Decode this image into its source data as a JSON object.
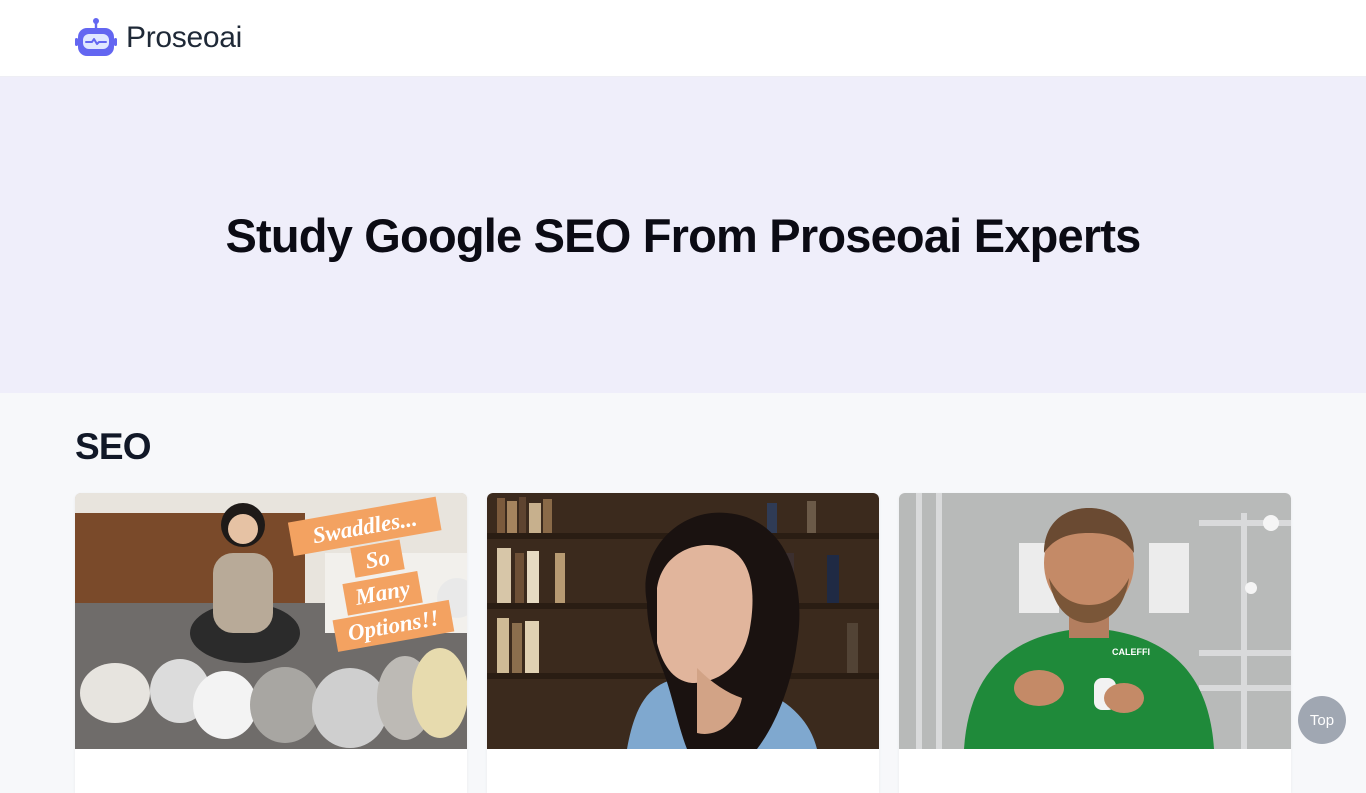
{
  "brand": {
    "name": "Proseoai",
    "icon": "robot-icon",
    "accent": "#6366f1"
  },
  "hero": {
    "title": "Study Google SEO From Proseoai Experts",
    "background": "#efeefa"
  },
  "section": {
    "title": "SEO",
    "cards": [
      {
        "image": "swaddles-video-thumbnail",
        "overlay_lines": [
          "Swaddles...",
          "So",
          "Many",
          "Options!!"
        ]
      },
      {
        "image": "woman-bookshelf-thumbnail"
      },
      {
        "image": "plumber-caleffi-thumbnail",
        "shirt_logo": "CALEFFI"
      }
    ]
  },
  "scroll_top": {
    "label": "Top",
    "icon": "scroll-to-top"
  }
}
